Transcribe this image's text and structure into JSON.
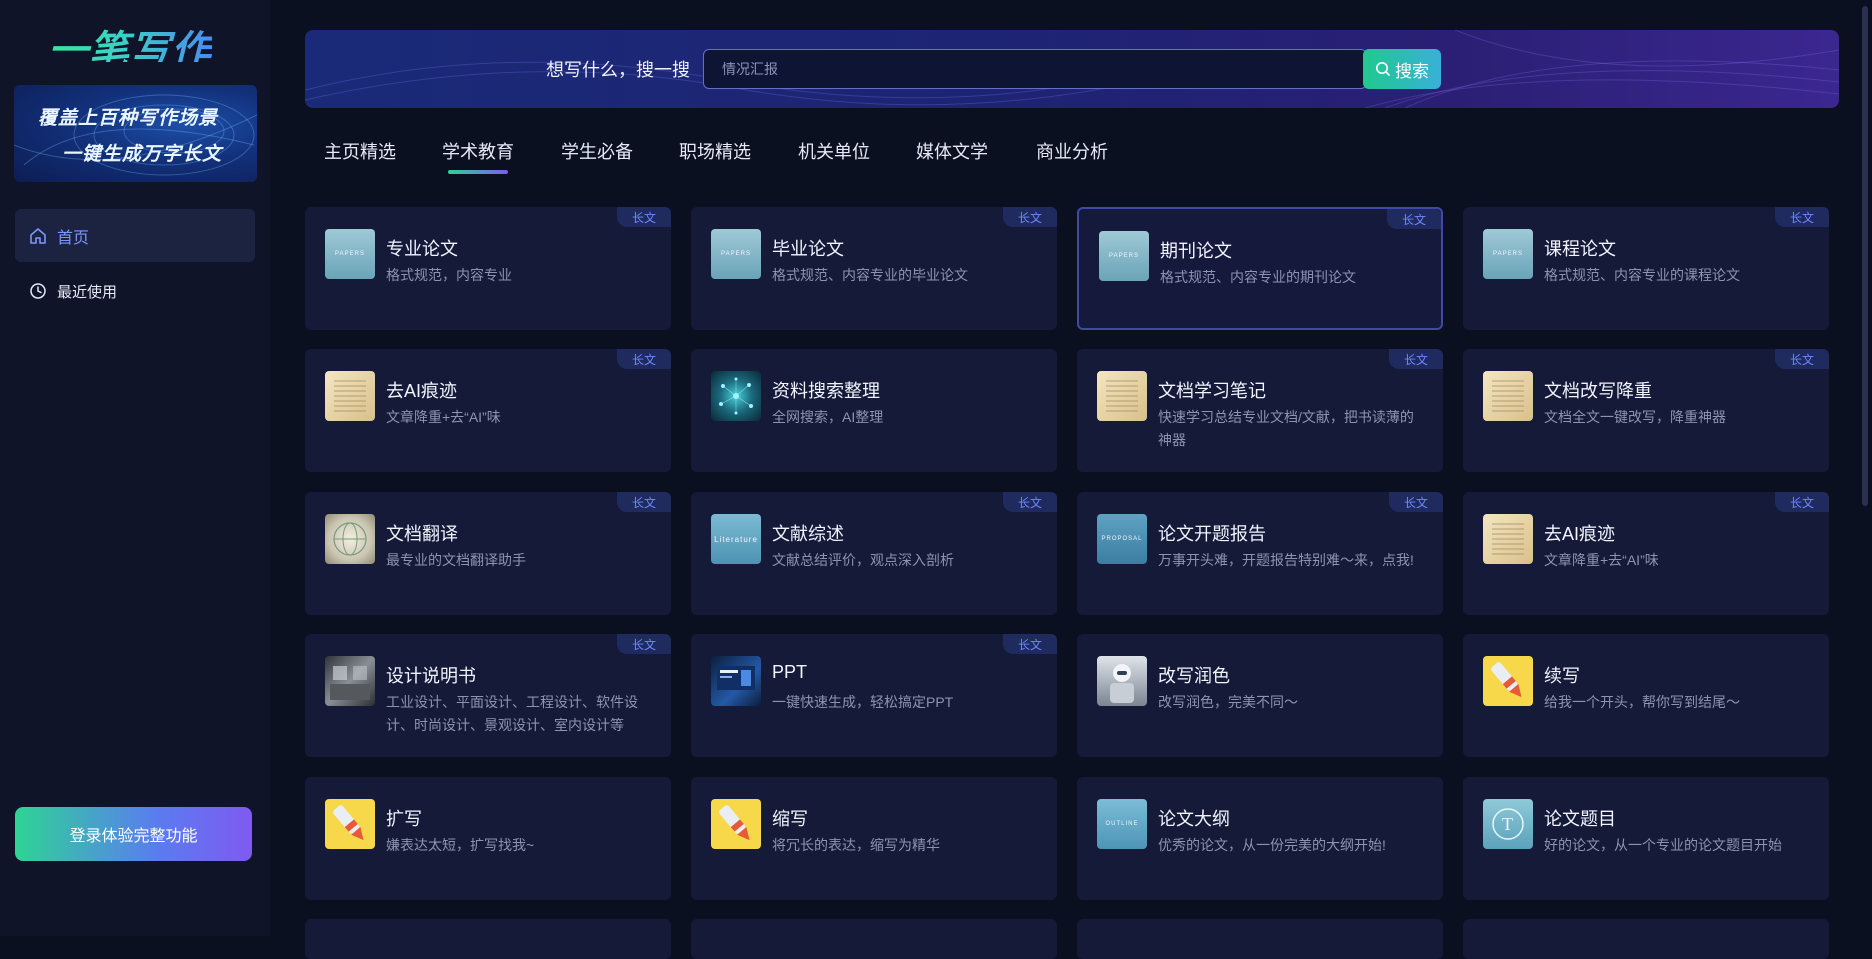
{
  "sidebar": {
    "logo_text": "一笔写作",
    "banner": {
      "line1": "覆盖上百种写作场景",
      "line2": "一键生成万字长文"
    },
    "nav": [
      {
        "label": "首页",
        "icon": "home-icon",
        "active": true
      },
      {
        "label": "最近使用",
        "icon": "clock-icon",
        "active": false
      }
    ],
    "login_button": "登录体验完整功能"
  },
  "search": {
    "prompt": "想写什么，搜一搜",
    "placeholder": "情况汇报",
    "button_label": "搜索"
  },
  "tabs": [
    {
      "label": "主页精选",
      "active": false
    },
    {
      "label": "学术教育",
      "active": true
    },
    {
      "label": "学生必备",
      "active": false
    },
    {
      "label": "职场精选",
      "active": false
    },
    {
      "label": "机关单位",
      "active": false
    },
    {
      "label": "媒体文学",
      "active": false
    },
    {
      "label": "商业分析",
      "active": false
    }
  ],
  "badge_label": "长文",
  "cards": [
    {
      "title": "专业论文",
      "desc": "格式规范，内容专业",
      "badge": true,
      "thumb": "papers",
      "thumb_text": "PAPERS"
    },
    {
      "title": "毕业论文",
      "desc": "格式规范、内容专业的毕业论文",
      "badge": true,
      "thumb": "papers",
      "thumb_text": "PAPERS"
    },
    {
      "title": "期刊论文",
      "desc": "格式规范、内容专业的期刊论文",
      "badge": true,
      "thumb": "papers",
      "thumb_text": "PAPERS",
      "selected": true
    },
    {
      "title": "课程论文",
      "desc": "格式规范、内容专业的课程论文",
      "badge": true,
      "thumb": "papers",
      "thumb_text": "PAPERS"
    },
    {
      "title": "去AI痕迹",
      "desc": "文章降重+去“AI”味",
      "badge": true,
      "thumb": "paperdoc"
    },
    {
      "title": "资料搜索整理",
      "desc": "全网搜索，AI整理",
      "badge": false,
      "thumb": "network"
    },
    {
      "title": "文档学习笔记",
      "desc": "快速学习总结专业文档/文献，把书读薄的神器",
      "badge": true,
      "thumb": "paperdoc"
    },
    {
      "title": "文档改写降重",
      "desc": "文档全文一键改写，降重神器",
      "badge": true,
      "thumb": "paperdoc"
    },
    {
      "title": "文档翻译",
      "desc": "最专业的文档翻译助手",
      "badge": true,
      "thumb": "translate"
    },
    {
      "title": "文献综述",
      "desc": "文献总结评价，观点深入剖析",
      "badge": true,
      "thumb": "literature",
      "thumb_text": "Literature"
    },
    {
      "title": "论文开题报告",
      "desc": "万事开头难，开题报告特别难～来，点我!",
      "badge": true,
      "thumb": "proposal",
      "thumb_text": "PROPOSAL"
    },
    {
      "title": "去AI痕迹",
      "desc": "文章降重+去“AI”味",
      "badge": true,
      "thumb": "paperdoc"
    },
    {
      "title": "设计说明书",
      "desc": "工业设计、平面设计、工程设计、软件设计、时尚设计、景观设计、室内设计等",
      "badge": true,
      "thumb": "design"
    },
    {
      "title": "PPT",
      "desc": "一键快速生成，轻松搞定PPT",
      "badge": true,
      "thumb": "ppt"
    },
    {
      "title": "改写润色",
      "desc": "改写润色，完美不同～",
      "badge": false,
      "thumb": "robot"
    },
    {
      "title": "续写",
      "desc": "给我一个开头，帮你写到结尾～",
      "badge": false,
      "thumb": "pen"
    },
    {
      "title": "扩写",
      "desc": "嫌表达太短，扩写找我~",
      "badge": false,
      "thumb": "pen"
    },
    {
      "title": "缩写",
      "desc": "将冗长的表达，缩写为精华",
      "badge": false,
      "thumb": "pen"
    },
    {
      "title": "论文大纲",
      "desc": "优秀的论文，从一份完美的大纲开始!",
      "badge": false,
      "thumb": "outline",
      "thumb_text": "OUTLINE"
    },
    {
      "title": "论文题目",
      "desc": "好的论文，从一个专业的论文题目开始",
      "badge": false,
      "thumb": "topic"
    }
  ],
  "colors": {
    "background": "#0b1021",
    "sidebar": "#0f1428",
    "card": "#141a38",
    "accent_blue": "#6f88ff",
    "accent_green": "#2ed495",
    "accent_purple": "#7f5af0"
  }
}
